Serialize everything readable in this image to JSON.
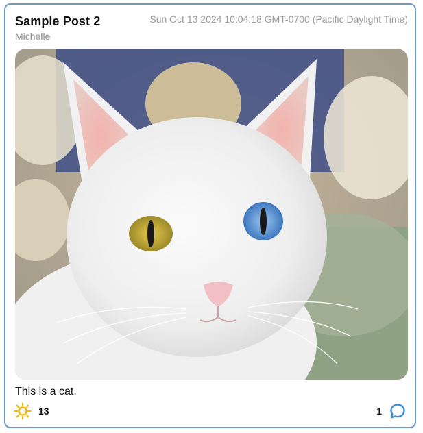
{
  "post": {
    "title": "Sample Post 2",
    "author": "Michelle",
    "date": "Sun Oct 13 2024 10:04:18 GMT-0700 (Pacific Daylight Time)",
    "caption": "This is a cat.",
    "image_subject": "white-cat-photo",
    "likes": "13",
    "comments": "1"
  },
  "icons": {
    "like": "sun-icon",
    "comment": "speech-bubble-icon"
  },
  "colors": {
    "card_border": "#6c9bc8",
    "like_icon": "#f2b705",
    "comment_icon": "#3d8fd6"
  }
}
